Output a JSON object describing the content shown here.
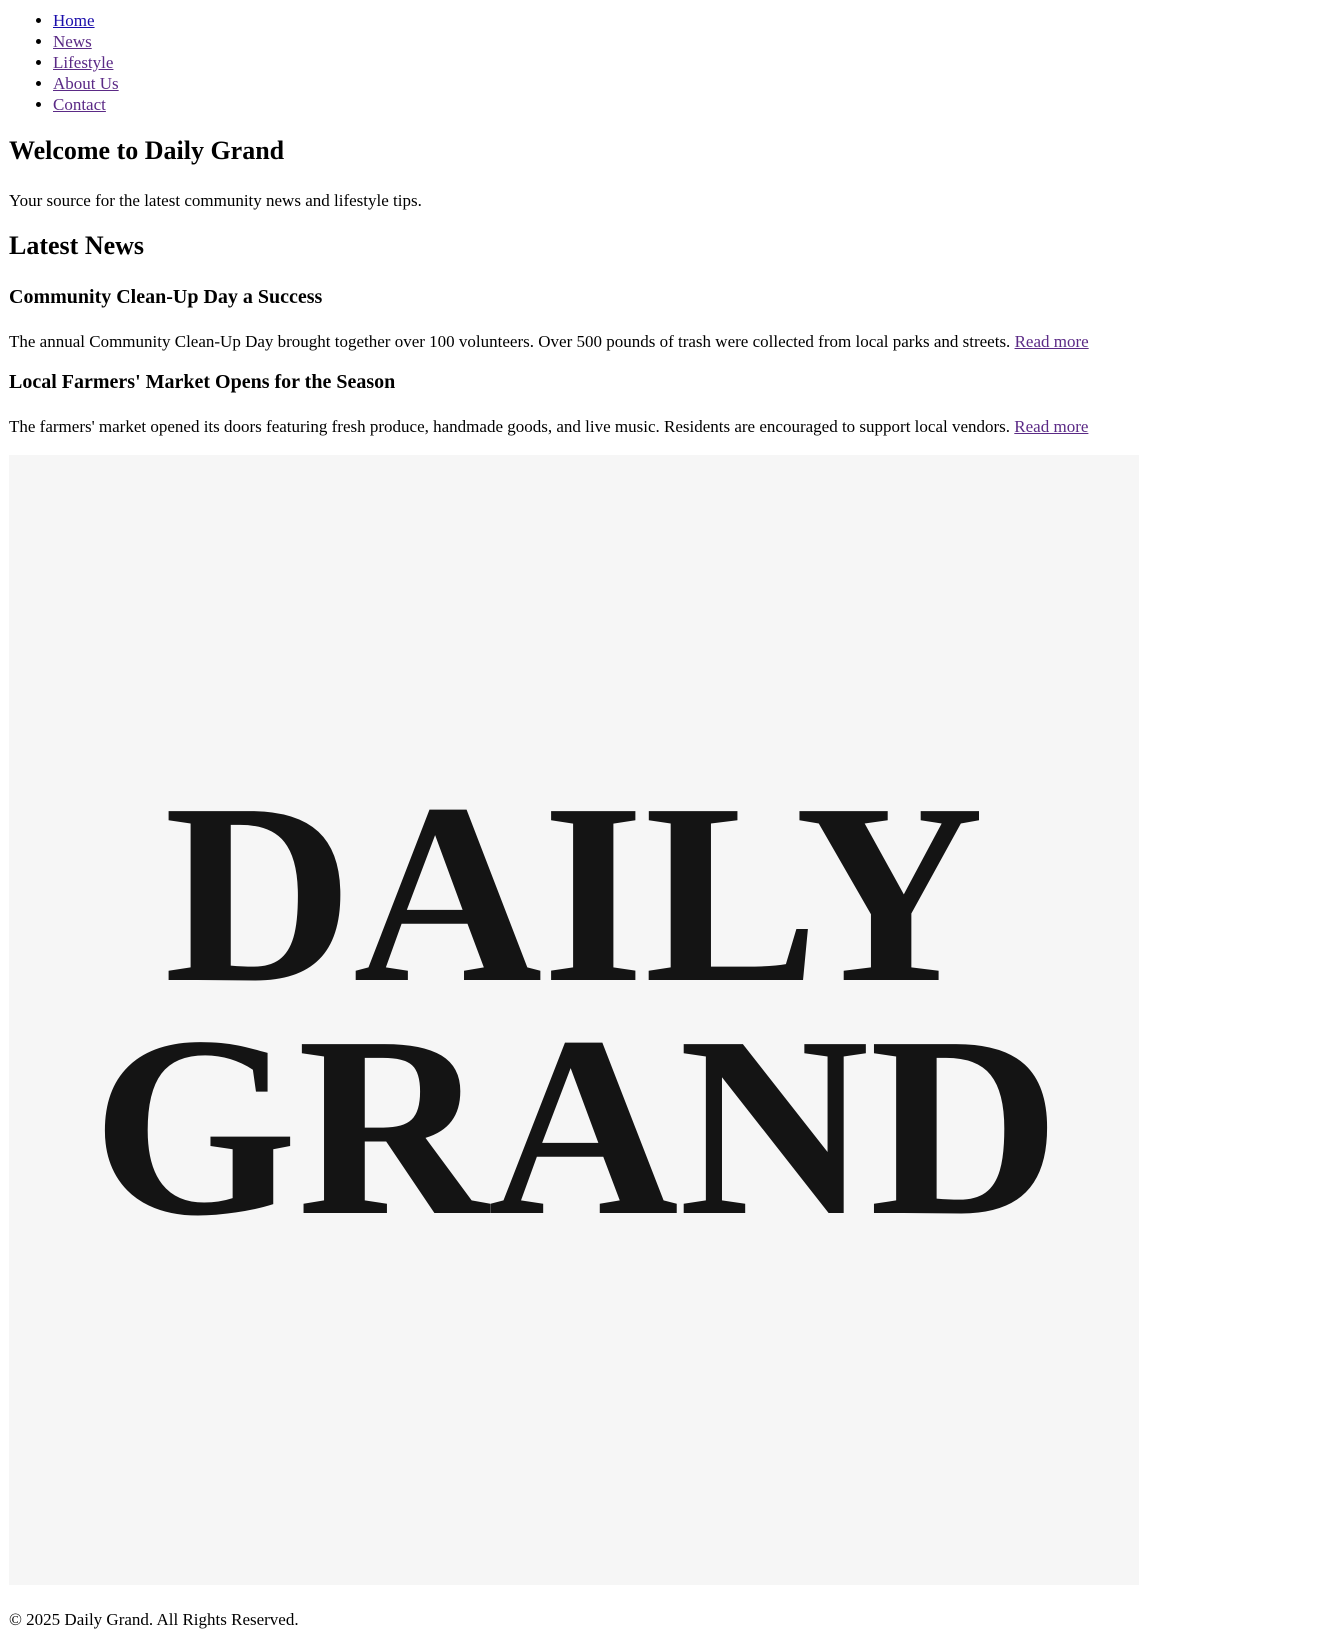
{
  "nav": {
    "items": [
      {
        "label": "Home"
      },
      {
        "label": "News"
      },
      {
        "label": "Lifestyle"
      },
      {
        "label": "About Us"
      },
      {
        "label": "Contact"
      }
    ]
  },
  "hero": {
    "title": "Welcome to Daily Grand",
    "text": "Your source for the latest community news and lifestyle tips."
  },
  "news": {
    "section_title": "Latest News",
    "articles": [
      {
        "title": "Community Clean-Up Day a Success",
        "summary": "The annual Community Clean-Up Day brought together over 100 volunteers. Over 500 pounds of trash were collected from local parks and streets.",
        "link_label": "Read more"
      },
      {
        "title": "Local Farmers' Market Opens for the Season",
        "summary": "The farmers' market opened its doors featuring fresh produce, handmade goods, and live music. Residents are encouraged to support local vendors.",
        "link_label": "Read more"
      }
    ]
  },
  "logo": {
    "line1": "DAILY",
    "line2": "GRAND",
    "background_color": "#f6f6f6",
    "text_color": "#141414"
  },
  "footer": {
    "text": "© 2025 Daily Grand. All Rights Reserved."
  },
  "colors": {
    "link": "#1a0dab",
    "visited_link": "#5b2a86"
  }
}
